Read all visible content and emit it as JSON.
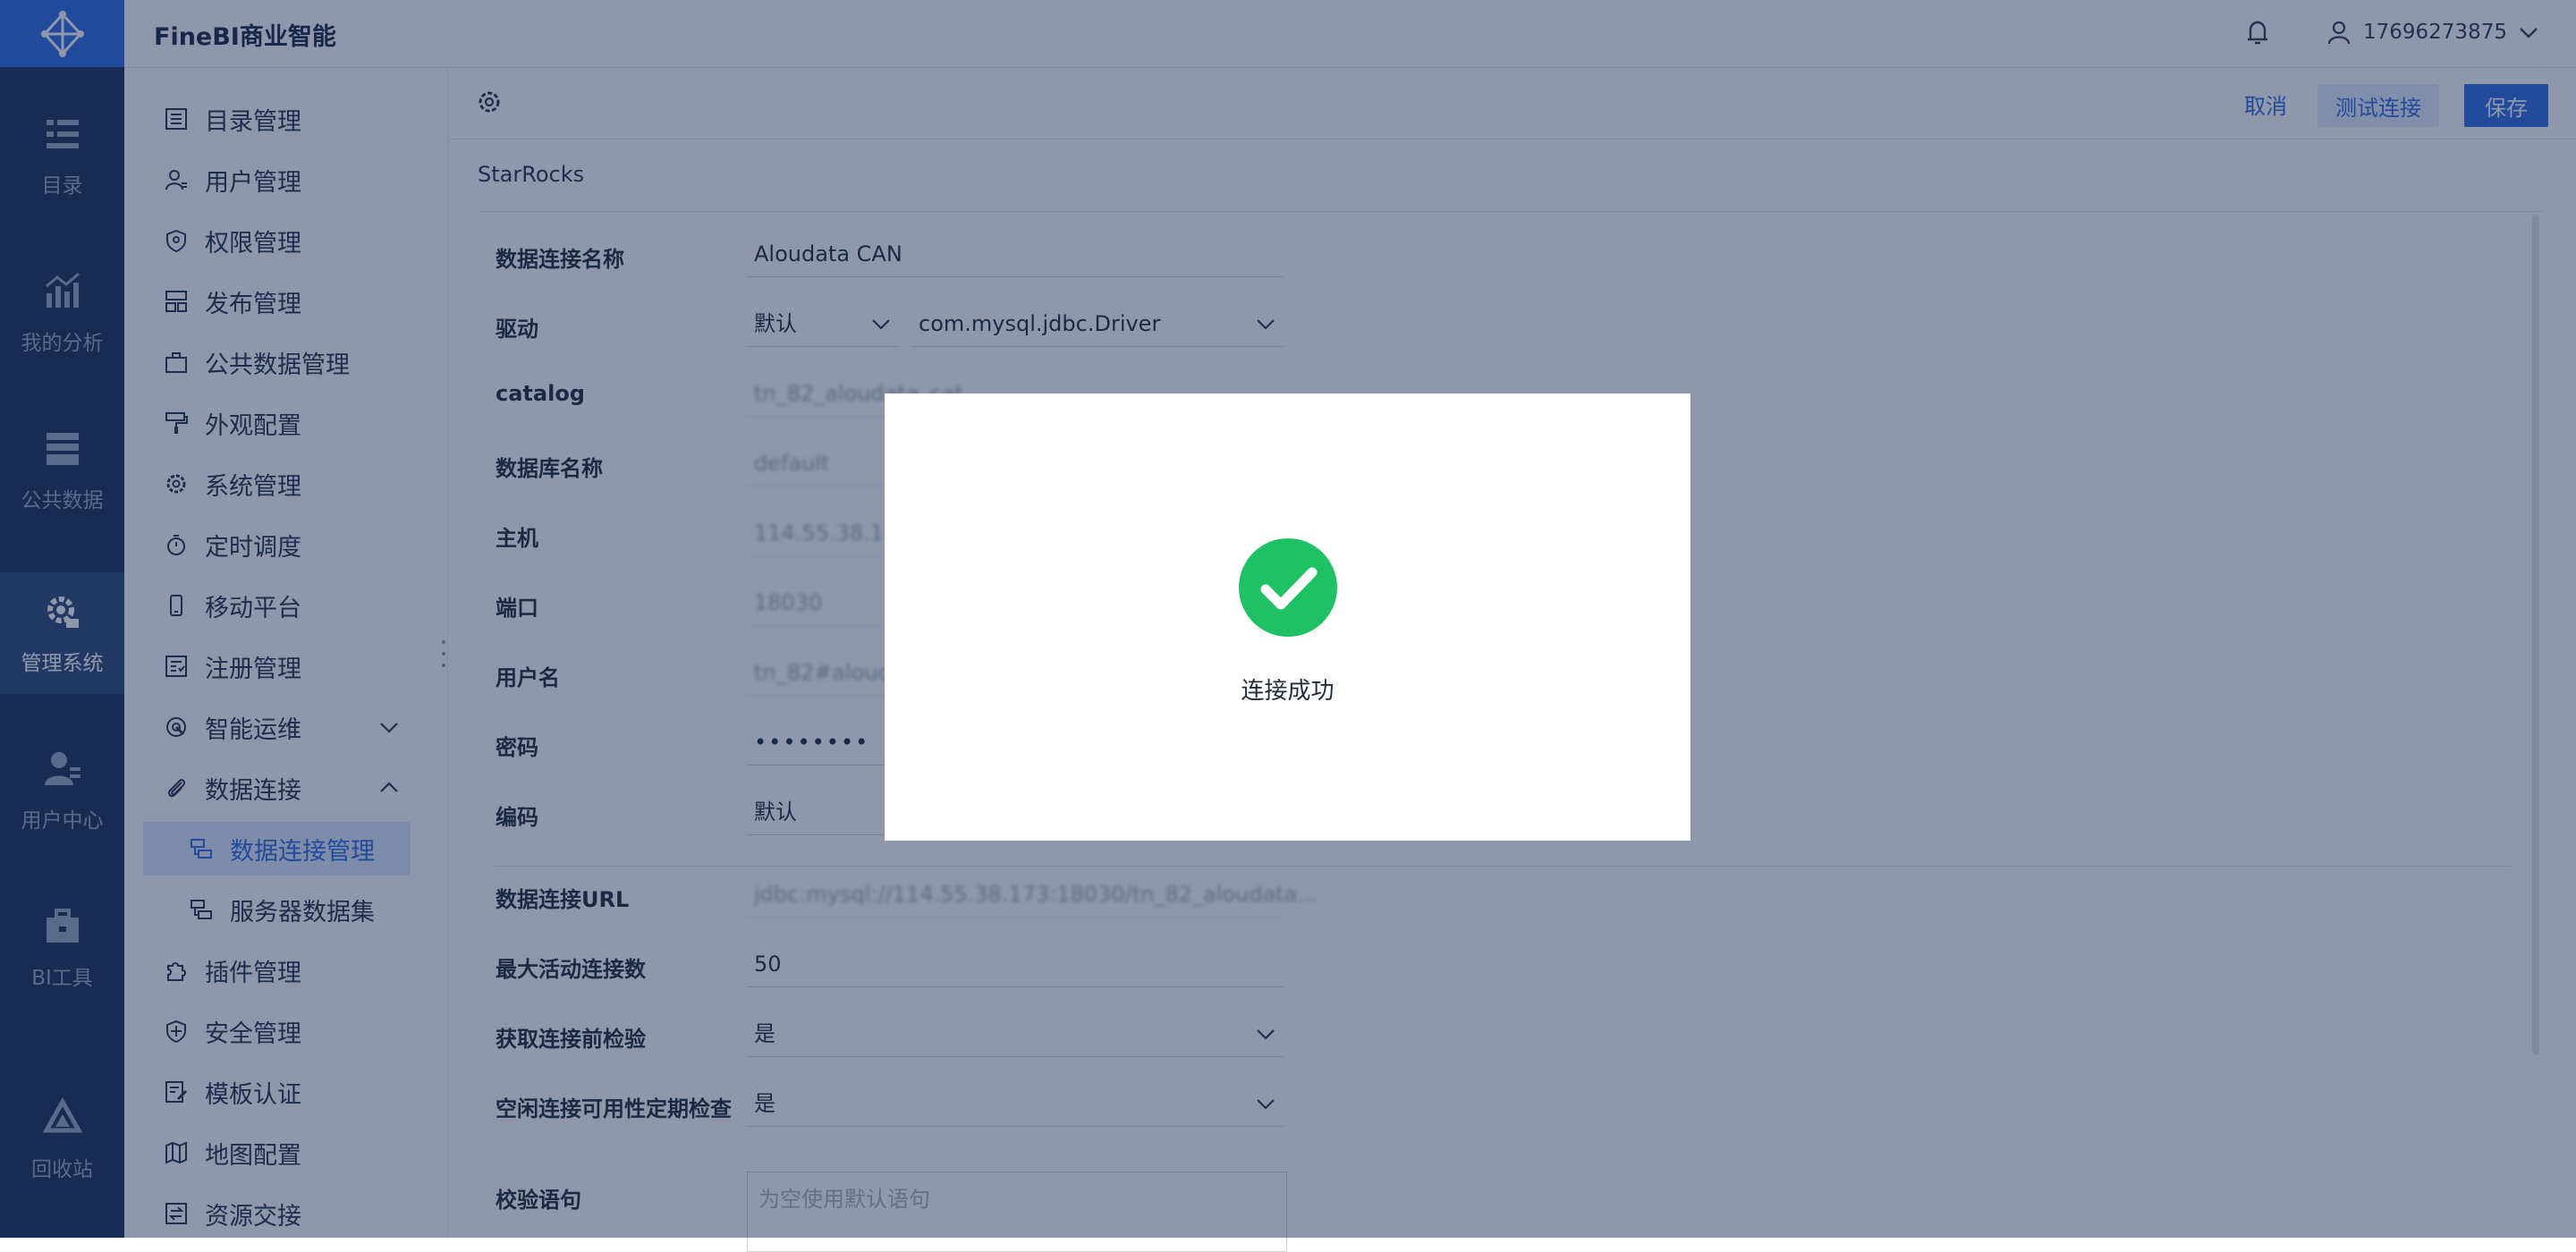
{
  "app": {
    "brand": "FineBI商业智能"
  },
  "header": {
    "username": "17696273875"
  },
  "rail": {
    "items": [
      {
        "label": "目录",
        "icon": "catalog-icon"
      },
      {
        "label": "我的分析",
        "icon": "analysis-icon"
      },
      {
        "label": "公共数据",
        "icon": "public-data-icon"
      },
      {
        "label": "管理系统",
        "icon": "admin-gear-icon",
        "active": true
      },
      {
        "label": "用户中心",
        "icon": "user-center-icon"
      },
      {
        "label": "BI工具",
        "icon": "toolbox-icon"
      },
      {
        "label": "回收站",
        "icon": "recycle-icon"
      }
    ]
  },
  "sidebar": {
    "items": [
      {
        "label": "目录管理"
      },
      {
        "label": "用户管理"
      },
      {
        "label": "权限管理"
      },
      {
        "label": "发布管理"
      },
      {
        "label": "公共数据管理"
      },
      {
        "label": "外观配置"
      },
      {
        "label": "系统管理"
      },
      {
        "label": "定时调度"
      },
      {
        "label": "移动平台"
      },
      {
        "label": "注册管理"
      },
      {
        "label": "智能运维"
      },
      {
        "label": "数据连接"
      },
      {
        "label": "数据连接管理"
      },
      {
        "label": "服务器数据集"
      },
      {
        "label": "插件管理"
      },
      {
        "label": "安全管理"
      },
      {
        "label": "模板认证"
      },
      {
        "label": "地图配置"
      },
      {
        "label": "资源交接"
      }
    ]
  },
  "toolbar": {
    "cancel_label": "取消",
    "test_label": "测试连接",
    "save_label": "保存"
  },
  "form": {
    "db_type": "StarRocks",
    "name_label": "数据连接名称",
    "name_value": "Aloudata CAN",
    "driver_label": "驱动",
    "driver_mode": "默认",
    "driver_class": "com.mysql.jdbc.Driver",
    "catalog_label": "catalog",
    "catalog_value": "tn_82_aloudata_cat",
    "dbname_label": "数据库名称",
    "dbname_value": "default",
    "host_label": "主机",
    "host_value": "114.55.38.173",
    "port_label": "端口",
    "port_value": "18030",
    "user_label": "用户名",
    "user_value": "tn_82#aloudata",
    "pwd_label": "密码",
    "pwd_value": "••••••••",
    "encoding_label": "编码",
    "encoding_value": "默认",
    "url_label": "数据连接URL",
    "url_value": "jdbc:mysql://114.55.38.173:18030/tn_82_aloudata...",
    "maxconn_label": "最大活动连接数",
    "maxconn_value": "50",
    "precheck_label": "获取连接前检验",
    "precheck_value": "是",
    "idlecheck_label": "空闲连接可用性定期检查",
    "idlecheck_value": "是",
    "validation_label": "校验语句",
    "validation_placeholder": "为空使用默认语句"
  },
  "modal": {
    "message": "连接成功"
  }
}
